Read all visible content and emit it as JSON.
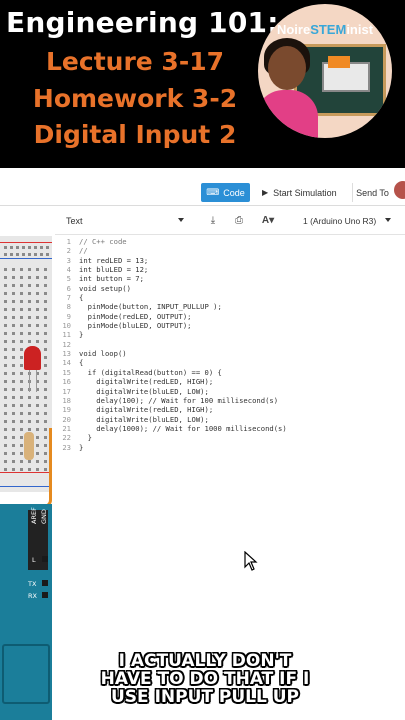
{
  "banner": {
    "title": "Engineering 101:",
    "lines": [
      "Lecture 3-17",
      "Homework 3-2",
      "Digital Input 2"
    ],
    "logo_text_prefix": "Noire",
    "logo_text_stem": "STEM",
    "logo_text_suffix": "inist"
  },
  "topbar": {
    "code_label": "Code",
    "simulate_label": "Start Simulation",
    "send_label": "Send To"
  },
  "editor_toolbar": {
    "mode_select": "Text",
    "board_select": "1 (Arduino Uno R3)"
  },
  "board_labels": {
    "aref": "AREF",
    "gnd": "GND",
    "l": "L",
    "tx": "TX",
    "rx": "RX"
  },
  "code_lines": [
    {
      "n": "1",
      "t": "// C++ code"
    },
    {
      "n": "2",
      "t": "//"
    },
    {
      "n": "3",
      "t": "int redLED = 13;"
    },
    {
      "n": "4",
      "t": "int bluLED = 12;"
    },
    {
      "n": "5",
      "t": "int button = 7;"
    },
    {
      "n": "6",
      "t": "void setup()"
    },
    {
      "n": "7",
      "t": "{"
    },
    {
      "n": "8",
      "t": "  pinMode(button, INPUT_PULLUP );"
    },
    {
      "n": "9",
      "t": "  pinMode(redLED, OUTPUT);"
    },
    {
      "n": "10",
      "t": "  pinMode(bluLED, OUTPUT);"
    },
    {
      "n": "11",
      "t": "}"
    },
    {
      "n": "12",
      "t": ""
    },
    {
      "n": "13",
      "t": "void loop()"
    },
    {
      "n": "14",
      "t": "{"
    },
    {
      "n": "15",
      "t": "  if (digitalRead(button) == 0) {"
    },
    {
      "n": "16",
      "t": "    digitalWrite(redLED, HIGH);"
    },
    {
      "n": "17",
      "t": "    digitalWrite(bluLED, LOW);"
    },
    {
      "n": "18",
      "t": "    delay(100); // Wait for 100 millisecond(s)"
    },
    {
      "n": "19",
      "t": "    digitalWrite(redLED, HIGH);"
    },
    {
      "n": "20",
      "t": "    digitalWrite(bluLED, LOW);"
    },
    {
      "n": "21",
      "t": "    delay(1000); // Wait for 1000 millisecond(s)"
    },
    {
      "n": "22",
      "t": "  }"
    },
    {
      "n": "23",
      "t": "}"
    }
  ],
  "caption": {
    "line1": "I ACTUALLY DON'T",
    "line2": "HAVE TO DO THAT IF I",
    "line3": "USE INPUT PULL UP"
  },
  "colors": {
    "accent": "#2b8fd6",
    "banner_orange": "#e8722a",
    "arduino_teal": "#1b7e9a"
  },
  "icons": [
    "code-icon",
    "play-icon",
    "download-icon",
    "print-icon",
    "font-size-icon",
    "cursor-arrow-icon"
  ]
}
